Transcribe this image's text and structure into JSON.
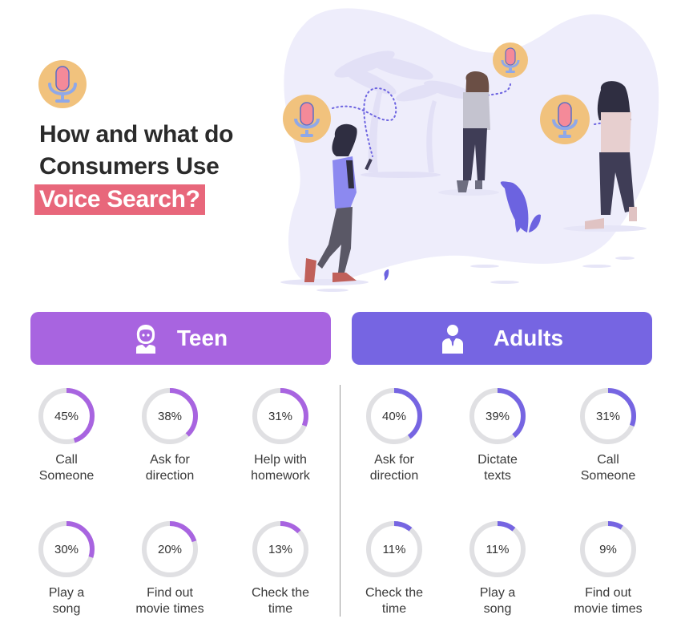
{
  "header": {
    "title_line1": "How and what do",
    "title_line2": "Consumers Use",
    "title_highlight": "Voice Search?",
    "icon": "microphone-icon"
  },
  "colors": {
    "teen_accent": "#a864e0",
    "adult_accent": "#7665e2",
    "highlight": "#e8677b",
    "ring_track": "#e0e0e3",
    "mic_badge": "#f1c27d",
    "mic_head": "#f48a99",
    "mic_stand": "#8fa8e8"
  },
  "groups": {
    "teen": {
      "label": "Teen",
      "icon": "teen-person-icon",
      "stats": [
        {
          "percent": 45,
          "display": "45%",
          "line1": "Call",
          "line2": "Someone"
        },
        {
          "percent": 38,
          "display": "38%",
          "line1": "Ask for",
          "line2": "direction"
        },
        {
          "percent": 31,
          "display": "31%",
          "line1": "Help with",
          "line2": "homework"
        },
        {
          "percent": 30,
          "display": "30%",
          "line1": "Play a",
          "line2": "song"
        },
        {
          "percent": 20,
          "display": "20%",
          "line1": "Find out",
          "line2": "movie times"
        },
        {
          "percent": 13,
          "display": "13%",
          "line1": "Check the",
          "line2": "time"
        }
      ]
    },
    "adults": {
      "label": "Adults",
      "icon": "adult-businessman-icon",
      "stats": [
        {
          "percent": 40,
          "display": "40%",
          "line1": "Ask for",
          "line2": "direction"
        },
        {
          "percent": 39,
          "display": "39%",
          "line1": "Dictate",
          "line2": "texts"
        },
        {
          "percent": 31,
          "display": "31%",
          "line1": "Call",
          "line2": "Someone"
        },
        {
          "percent": 11,
          "display": "11%",
          "line1": "Check the",
          "line2": "time"
        },
        {
          "percent": 11,
          "display": "11%",
          "line1": "Play a",
          "line2": "song"
        },
        {
          "percent": 9,
          "display": "9%",
          "line1": "Find out",
          "line2": "movie times"
        }
      ]
    }
  }
}
